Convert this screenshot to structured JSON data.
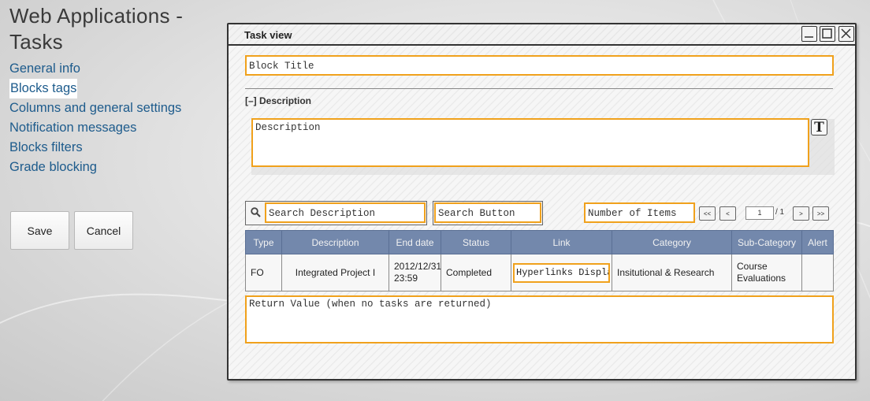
{
  "page": {
    "title": "Web Applications - Tasks"
  },
  "nav": {
    "items": [
      {
        "label": "General info"
      },
      {
        "label": "Blocks tags"
      },
      {
        "label": "Columns and general settings"
      },
      {
        "label": "Notification messages"
      },
      {
        "label": "Blocks filters"
      },
      {
        "label": "Grade blocking"
      }
    ],
    "active_index": 1
  },
  "actions": {
    "save_label": "Save",
    "cancel_label": "Cancel"
  },
  "window": {
    "title": "Task view",
    "block_title": "Block Title",
    "description_section": "[–] Description",
    "description_placeholder": "Description",
    "search_description": "Search Description",
    "search_button": "Search Button",
    "number_of_items": "Number of Items",
    "pager": {
      "first": "<<",
      "prev": "<",
      "page": "1",
      "total": "/ 1",
      "next": ">",
      "last": ">>"
    },
    "table": {
      "headers": [
        "Type",
        "Description",
        "End date",
        "Status",
        "Link",
        "Category",
        "Sub-Category",
        "Alert"
      ],
      "row": {
        "type": "FO",
        "description": "Integrated Project I",
        "end_date_line1": "2012/12/31",
        "end_date_line2": "23:59",
        "status": "Completed",
        "link": "Hyperlinks Display",
        "category": "Insitutional & Research",
        "subcategory_line1": "Course",
        "subcategory_line2": "Evaluations",
        "alert": ""
      }
    },
    "return_value": "Return Value (when no tasks are returned)"
  },
  "icons": {
    "search": "magnifier-icon",
    "text_format": "T-icon",
    "window_min": "minimize-icon",
    "window_max": "maximize-icon",
    "window_close": "close-icon"
  },
  "colors": {
    "accent_border": "#f0a11c",
    "link_blue": "#1d5b8c",
    "table_header": "#7388ac"
  }
}
